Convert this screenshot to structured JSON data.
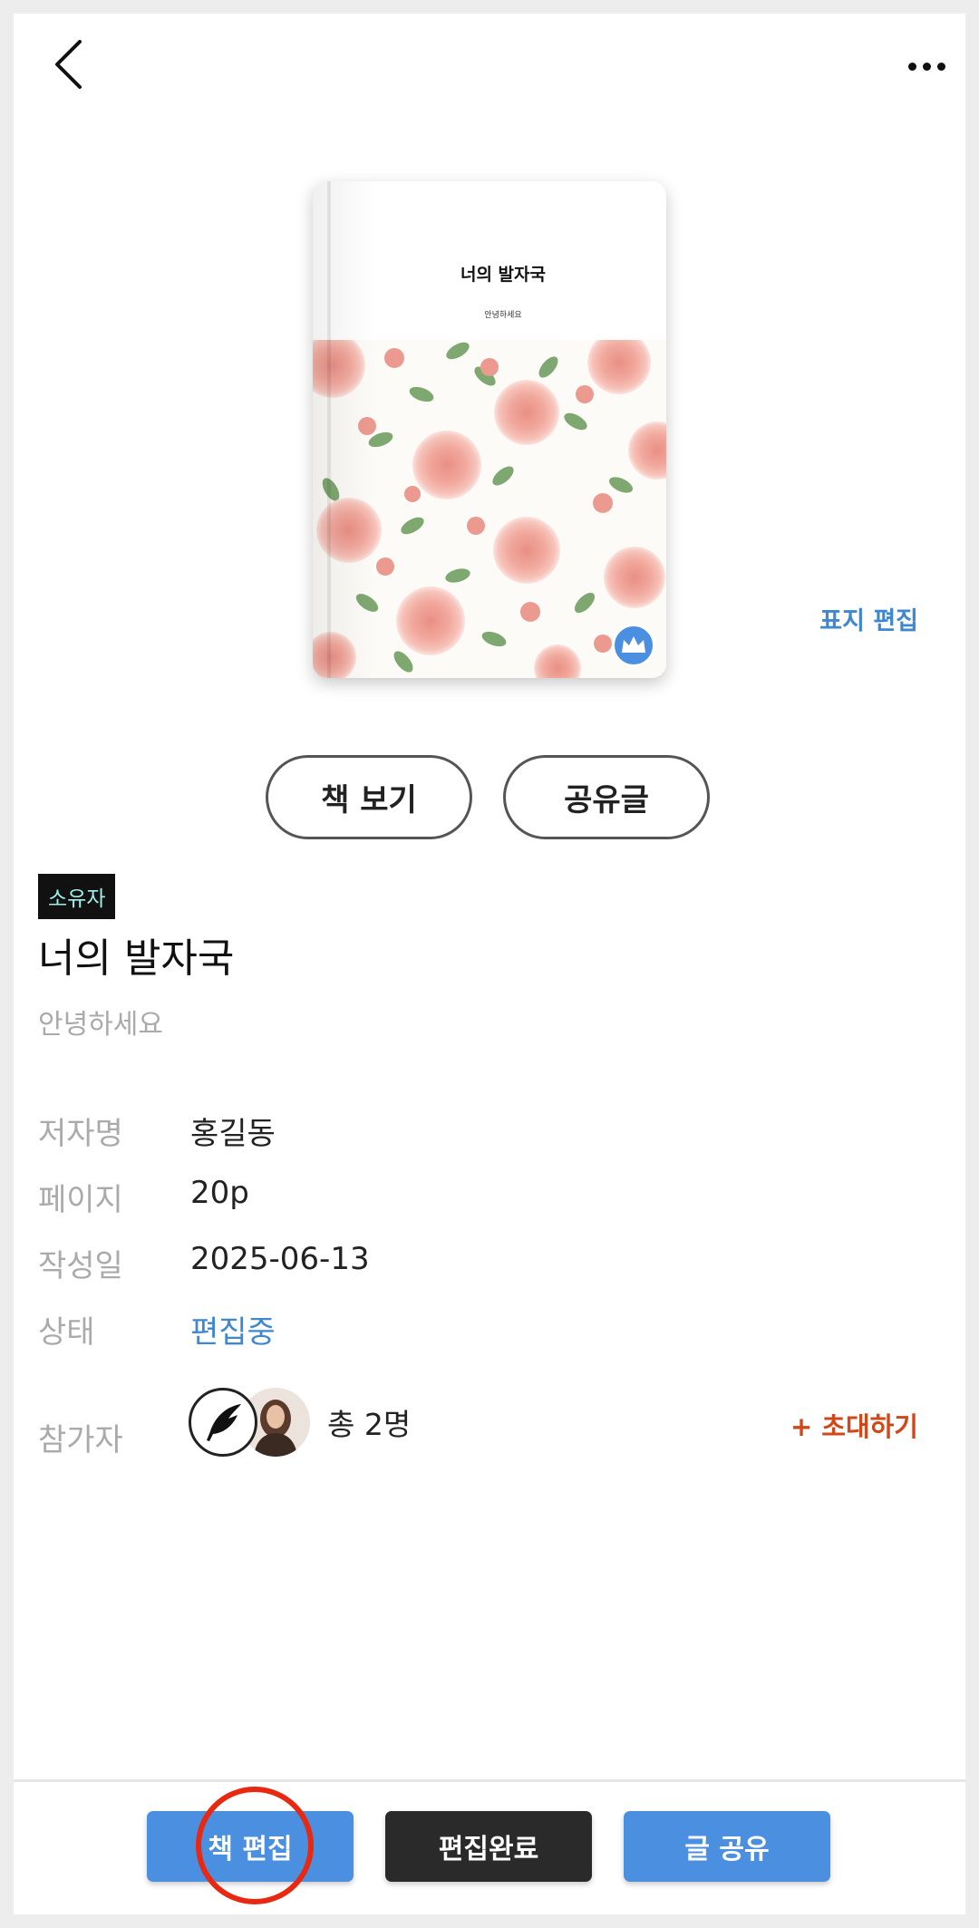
{
  "header": {
    "back_icon": "chevron-left-icon",
    "more_icon": "more-horizontal-icon"
  },
  "cover": {
    "title": "너의 발자국",
    "subtitle": "안녕하세요",
    "badge_icon": "crown-icon",
    "edit_label": "표지 편집"
  },
  "actions": {
    "view_book": "책 보기",
    "share_post": "공유글"
  },
  "book": {
    "owner_badge": "소유자",
    "title": "너의 발자국",
    "subtitle": "안녕하세요",
    "info": [
      {
        "label": "저자명",
        "value": "홍길동"
      },
      {
        "label": "페이지",
        "value": "20p"
      },
      {
        "label": "작성일",
        "value": "2025-06-13"
      },
      {
        "label": "상태",
        "value": "편집중"
      }
    ]
  },
  "participants": {
    "label": "참가자",
    "count": "총 2명",
    "invite": "+ 초대하기",
    "avatar_icons": [
      "feather-icon",
      "user-photo"
    ]
  },
  "bottom_bar": {
    "edit_book": "책 편집",
    "finish_edit": "편집완료",
    "share_text": "글 공유"
  },
  "colors": {
    "accent_blue": "#4a8fe0",
    "link_blue": "#3e87d1",
    "invite_red": "#d2471a",
    "dark": "#2a2a2a",
    "annotation_red": "#e82810"
  }
}
